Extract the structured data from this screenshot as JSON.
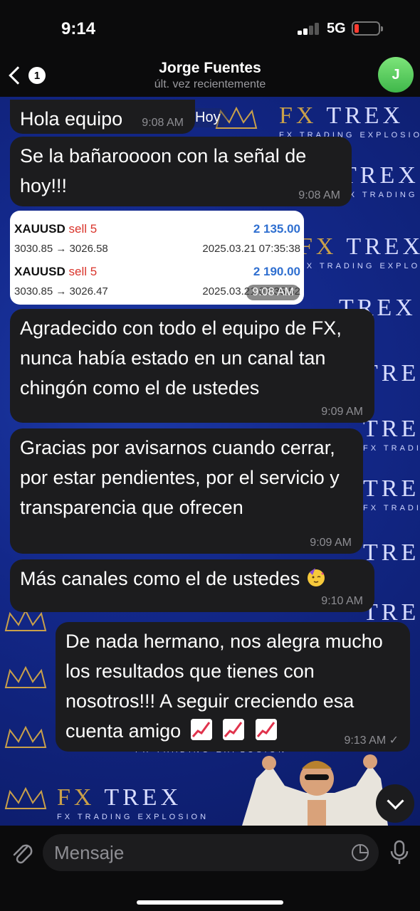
{
  "status_bar": {
    "time": "9:14",
    "network": "5G"
  },
  "header": {
    "unread_count": "1",
    "contact_name": "Jorge Fuentes",
    "last_seen": "últ. vez recientemente",
    "avatar_initial": "J"
  },
  "watermark": {
    "brand_fx": "FX",
    "brand_trex": "TREX",
    "tagline": "FX TRADING EXPLOSION"
  },
  "chat": {
    "date_label": "Hoy",
    "messages": [
      {
        "text": "Hola equipo",
        "time": "9:08 AM"
      },
      {
        "text": "Se la bañaroooon con la señal de hoy!!!",
        "time": "9:08 AM"
      },
      {
        "type": "image",
        "time": "9:08 AM",
        "trades": [
          {
            "symbol": "XAUUSD",
            "side": "sell 5",
            "prices": "3030.85 → 3026.58",
            "profit": "2 135.00",
            "date": "2025.03.21 07:35:38"
          },
          {
            "symbol": "XAUUSD",
            "side": "sell 5",
            "prices": "3030.85 → 3026.47",
            "profit": "2 190.00",
            "date": "2025.03.21 07:35:52"
          }
        ]
      },
      {
        "text": "Agradecido con todo el equipo de FX, nunca había estado en un canal tan chingón como el de ustedes",
        "time": "9:09 AM"
      },
      {
        "text": "Gracias por avisarnos cuando cerrar, por estar pendientes, por el servicio y transparencia que ofrecen",
        "time": "9:09 AM"
      },
      {
        "text": "Más canales como el de ustedes",
        "emoji": "partying-face",
        "time": "9:10 AM"
      },
      {
        "text": "De nada hermano, nos alegra mucho los resultados que tienes con nosotros!!! A seguir creciendo esa cuenta amigo",
        "emoji": "chart-increasing x3",
        "time": "9:13 AM",
        "outgoing": true
      }
    ]
  },
  "input": {
    "placeholder": "Mensaje"
  },
  "colors": {
    "bubble": "#1c1c1e",
    "chat_bg": "#13288a",
    "accent_gold": "#c9a04a",
    "profit_blue": "#2f6fd0",
    "sell_red": "#d9342b"
  }
}
